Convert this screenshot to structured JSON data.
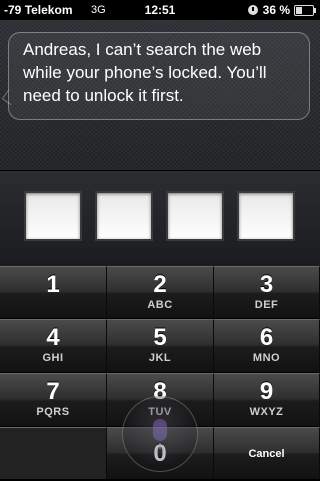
{
  "status_bar": {
    "signal": "-79",
    "carrier": "Telekom",
    "network": "3G",
    "time": "12:51",
    "battery_percent": "36 %",
    "battery_level": 0.36
  },
  "siri": {
    "message": "Andreas, I can’t search the web while your phone’s locked. You’ll need to unlock it first."
  },
  "passcode": {
    "entered_digits": 0
  },
  "keypad": {
    "keys": [
      {
        "digit": "1",
        "letters": ""
      },
      {
        "digit": "2",
        "letters": "ABC"
      },
      {
        "digit": "3",
        "letters": "DEF"
      },
      {
        "digit": "4",
        "letters": "GHI"
      },
      {
        "digit": "5",
        "letters": "JKL"
      },
      {
        "digit": "6",
        "letters": "MNO"
      },
      {
        "digit": "7",
        "letters": "PQRS"
      },
      {
        "digit": "8",
        "letters": "TUV"
      },
      {
        "digit": "9",
        "letters": "WXYZ"
      },
      {
        "digit": "0",
        "letters": ""
      }
    ],
    "cancel_label": "Cancel",
    "mic_icon": "microphone-icon"
  },
  "colors": {
    "siri_background": "#25272b",
    "key_top": "#4b4b4b",
    "key_bottom": "#121212",
    "text": "#ffffff"
  }
}
